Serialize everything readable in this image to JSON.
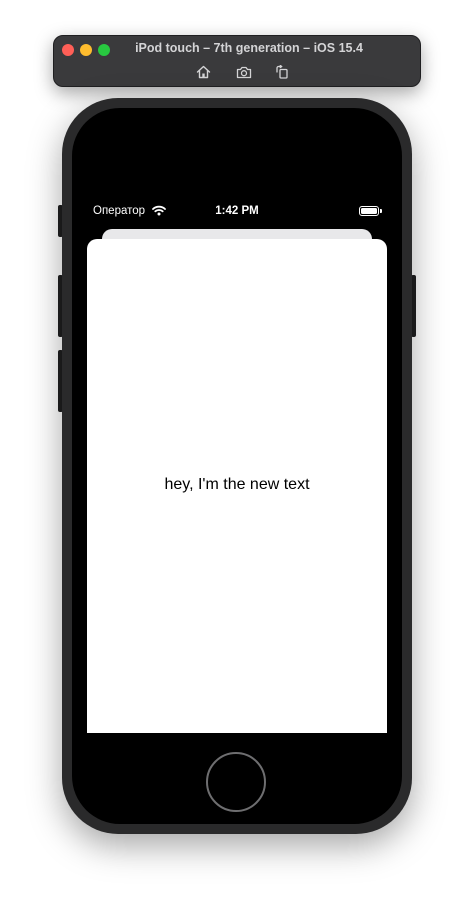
{
  "simulator": {
    "title": "iPod touch – 7th generation – iOS 15.4",
    "toolbar": {
      "home_icon": "home-icon",
      "screenshot_icon": "camera-icon",
      "rotate_icon": "rotate-icon"
    },
    "colors": {
      "close": "#ff5f57",
      "minimize": "#febc2e",
      "zoom": "#28c840"
    }
  },
  "status_bar": {
    "carrier": "Оператор",
    "time": "1:42 PM",
    "wifi_icon": "wifi-icon",
    "battery_icon": "battery-icon"
  },
  "sheet": {
    "text": "hey, I'm the new text"
  }
}
